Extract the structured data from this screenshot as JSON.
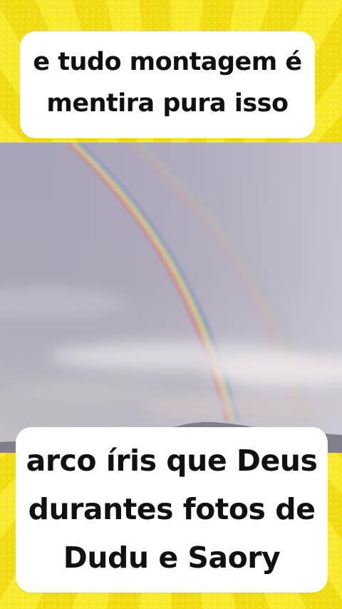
{
  "top_caption": {
    "line1": "e tudo montagem é",
    "line2": "mentira pura isso"
  },
  "bottom_caption": {
    "line1": "arco íris que Deus",
    "line2": "durantes fotos de",
    "line3": "Dudu e Saory"
  },
  "colors": {
    "background_yellow": "#f5e41c",
    "caption_background": "#ffffff",
    "caption_text": "#111111"
  }
}
